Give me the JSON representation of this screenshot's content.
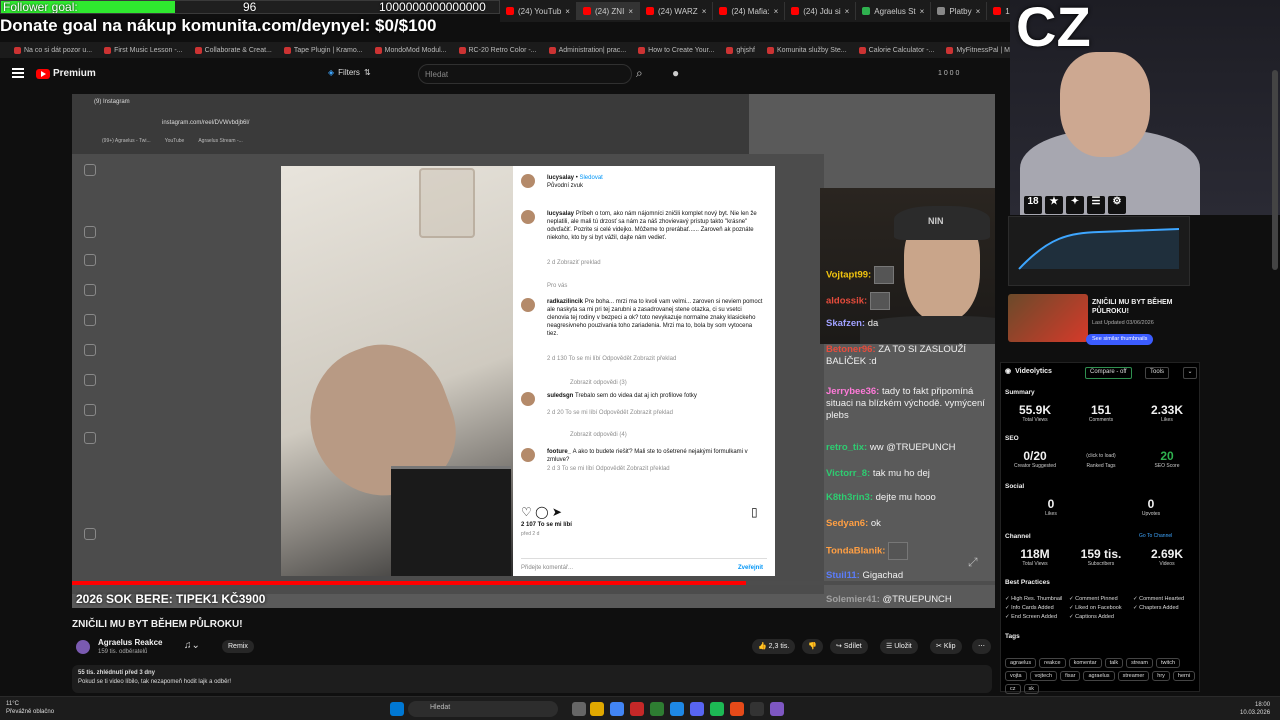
{
  "overlay": {
    "goal_label": "Follower goal:",
    "goal_current": "96",
    "goal_target": "1000000000000000",
    "goal_progress": 0.35,
    "donate_text": "Donate goal na nákup komunita.com/deynyel: $0/$100",
    "cz_logo": "CZ"
  },
  "tabs": [
    {
      "label": "(24) YouTub",
      "color": "#f00"
    },
    {
      "label": "(24) ZNI",
      "color": "#f00",
      "active": true
    },
    {
      "label": "(24) WARZ",
      "color": "#f00"
    },
    {
      "label": "(24) Mafia:",
      "color": "#f00"
    },
    {
      "label": "(24) Jdu si",
      "color": "#f00"
    },
    {
      "label": "Agraelus St",
      "color": "#2fb14f"
    },
    {
      "label": "Platby",
      "color": "#888"
    },
    {
      "label": "1720 - Wi",
      "color": "#f00"
    }
  ],
  "bookmarks": [
    "Na co si dát pozor u...",
    "First Music Lesson -...",
    "Collaborate & Creat...",
    "Tape Plugin | Kramo...",
    "MondoMod Modul...",
    "RC-20 Retro Color -...",
    "Administration| prac...",
    "How to Create Your...",
    "ghjshf",
    "Komunita služby Ste...",
    "Calorie Calculator -...",
    "MyFitnessPal | MyFit...",
    "Cha - Cha by Simon..."
  ],
  "yt": {
    "logo": "Premium",
    "filters": "Filters",
    "search_placeholder": "Hledat",
    "counts": "1  0  0  0"
  },
  "instagram": {
    "tab": "(9) Instagram",
    "url": "instagram.com/reel/DVWvbdjb6l/",
    "bm1": "(99+) Agraelus - Twi...",
    "bm2": "YouTube",
    "bm3": "Agraelus Stream -...",
    "author": "lucysalay",
    "follow": "Sledovat",
    "sound": "Původní zvuk",
    "comments": [
      {
        "user": "lucysalay",
        "text": "Príbeh o tom, ako nám nájomníci zničili komplet nový byt. Nie len že neplatili, ale mali tú drzosť sa nám za náš zhovievavý prístup takto \"krásne\" odvďačiť. Pozrite si celé videjko. Môžeme to prerábať...... Zaroveň ak poznáte niekoho, kto by si byt vážil, dajte nám vedieť.",
        "meta": "2 d   Zobraziť preklad"
      },
      {
        "user": "radkazilincik",
        "text": "Pre boha... mrzi ma to kvoli vam velmi... zaroven si neviem pomoct ale naskyta sa mi pri tej zarubni a zasadrovanej stene otazka, ci su vsetci clenovia tej rodiny v bezpeci a ok? toto nevykazuje normalne znaky klasickeho neagresivneho pouzivania toho zariadenia. Mrzi ma to, bola by som vytocena tiez.",
        "meta": "2 d   130 To se mi líbí   Odpovědět   Zobrazit překlad"
      },
      {
        "user": "suledsgn",
        "text": "Trebalo sem do videa dat aj ich profilove fotky",
        "meta": "2 d   20 To se mi líbí   Odpovědět   Zobrazit překlad"
      },
      {
        "user": "footure_",
        "text": "A ako to budete riešiť? Mali ste to ošetrené nejakými formulkami v zmluve?",
        "meta": "2 d   3 To se mi líbí   Odpovědět   Zobrazit překlad"
      }
    ],
    "pro_vas": "Pro vás",
    "reply1": "Zobrazit odpovědi (3)",
    "reply2": "Zobrazit odpovědi (4)",
    "likes": "2 107 To se mi líbí",
    "added": "před 2 d",
    "add_comment": "Přidejte komentář...",
    "post": "Zveřejnit"
  },
  "stream_overlay": {
    "title": "2026 SOK BERE: TIPEK1 KČ3900",
    "progress": 0.73
  },
  "chat": [
    {
      "user": "Vojtapt99:",
      "text": "",
      "emote": true,
      "color": "#f1c40f"
    },
    {
      "user": "aldossik:",
      "text": "",
      "emote": true,
      "color": "#e74c3c"
    },
    {
      "user": "Skafzen:",
      "text": "da",
      "color": "#a0a0ff"
    },
    {
      "user": "Betoner96:",
      "text": "ZA TO SI ZASLOUŽÍ BALÍČEK :d",
      "color": "#e74c3c"
    },
    {
      "user": "Jerrybee36:",
      "text": "tady to fakt připomíná situaci na blízkém východě. vymýcení plebs",
      "color": "#ff7ad9"
    },
    {
      "user": "retro_tix:",
      "text": "ww @TRUEPUNCH",
      "color": "#2ecc71"
    },
    {
      "user": "Victorr_8:",
      "text": "tak mu ho dej",
      "color": "#2ecc71"
    },
    {
      "user": "K8th3rin3:",
      "text": "dejte mu hooo",
      "color": "#2ecc71"
    },
    {
      "user": "Sedyan6:",
      "text": "ok",
      "color": "#ff9f43"
    },
    {
      "user": "TondaBlanik:",
      "text": "",
      "emote": true,
      "color": "#ff9f43"
    },
    {
      "user": "Stuil11:",
      "text": "Gigachad",
      "color": "#5b7cfa"
    },
    {
      "user": "Solemier41:",
      "text": "@TRUEPUNCH",
      "color": "#a0a0a0"
    }
  ],
  "badges": [
    "18",
    "★",
    "✦",
    "☰",
    "⚙"
  ],
  "sidebar_video": {
    "title": "ZNIČILI MU BYT BĚHEM PŮLROKU!",
    "date": "Last Updated 03/06/2026",
    "button": "See similar thumbnails"
  },
  "videolytics": {
    "title": "Videolytics",
    "compare": "Compare - off",
    "tools": "Tools",
    "summary": "Summary",
    "views": "55.9K",
    "views_l": "Total Views",
    "comments": "151",
    "comments_l": "Comments",
    "likes": "2.33K",
    "likes_l": "Likes",
    "seo": "SEO",
    "creator": "0/20",
    "creator_l": "Creator Suggested",
    "ranked": "(click to load)",
    "ranked_l": "Ranked Tags",
    "seo_score": "20",
    "seo_score_l": "SEO Score",
    "social": "Social",
    "s_likes": "0",
    "s_likes_l": "Likes",
    "upvotes": "0",
    "upvotes_l": "Upvotes",
    "channel": "Channel",
    "go": "Go To Channel",
    "c_views": "118M",
    "c_views_l": "Total Views",
    "subs": "159 tis.",
    "subs_l": "Subscribers",
    "videos": "2.69K",
    "videos_l": "Videos",
    "best": "Best Practices",
    "bp": [
      "High Res. Thumbnail",
      "Comment Pinned",
      "Comment Hearted",
      "Info Cards Added",
      "Liked on Facebook",
      "Chapters Added",
      "End Screen Added",
      "Captions Added"
    ],
    "tags_l": "Tags",
    "tags": [
      "agraelus",
      "reakce",
      "komentar",
      "talk",
      "stream",
      "twitch",
      "vojta",
      "vojtech",
      "fisar",
      "agraelus",
      "streamer",
      "hry",
      "herni",
      "cz",
      "sk"
    ]
  },
  "below": {
    "title": "ZNIČILI MU BYT BĚHEM PŮLROKU!",
    "channel": "Agraelus Reakce",
    "subs": "159 tis. odběratelů",
    "remix": "Remix",
    "like": "2,3 tis.",
    "share": "Sdílet",
    "save": "Uložit",
    "clip": "Klip",
    "desc_top": "55 tis. zhlédnutí  před 3 dny",
    "desc_text": "Pokud se ti video líbilo, tak nezapomeň hodit lajk a odběr!"
  },
  "taskbar": {
    "temp": "11°C",
    "weather": "Převážně oblačno",
    "search": "Hledat",
    "time": "18:00",
    "date": "10.03.2026"
  }
}
